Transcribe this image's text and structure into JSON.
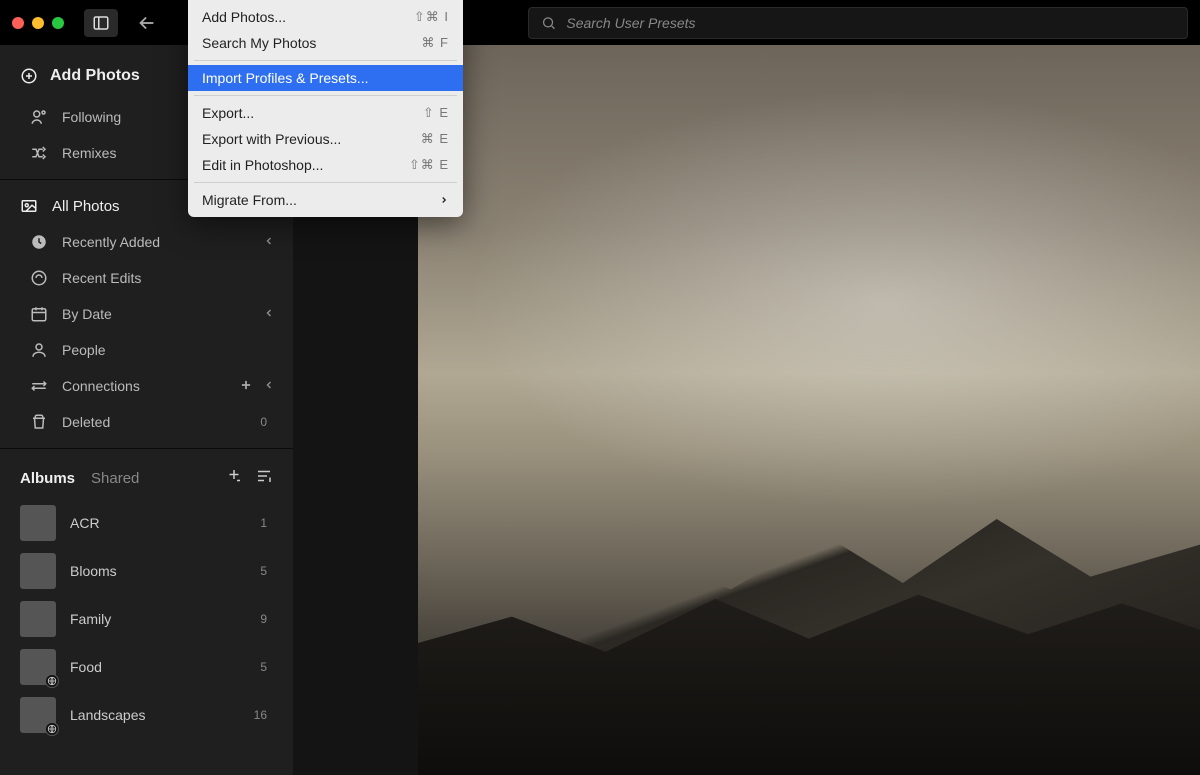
{
  "search": {
    "placeholder": "Search User Presets"
  },
  "addPhotos": "Add Photos",
  "nav": {
    "following": "Following",
    "remixes": "Remixes"
  },
  "library": {
    "allPhotos": "All Photos",
    "recentlyAdded": "Recently Added",
    "recentEdits": "Recent Edits",
    "byDate": "By Date",
    "people": "People",
    "connections": "Connections",
    "deleted": "Deleted",
    "deletedCount": "0"
  },
  "albumsHeader": {
    "albums": "Albums",
    "shared": "Shared"
  },
  "albums": [
    {
      "name": "ACR",
      "count": "1"
    },
    {
      "name": "Blooms",
      "count": "5"
    },
    {
      "name": "Family",
      "count": "9"
    },
    {
      "name": "Food",
      "count": "5"
    },
    {
      "name": "Landscapes",
      "count": "16"
    }
  ],
  "menu": {
    "addPhotos": {
      "label": "Add Photos...",
      "shortcut": "⇧⌘ I"
    },
    "searchMy": {
      "label": "Search My Photos",
      "shortcut": "⌘ F"
    },
    "importPresets": {
      "label": "Import Profiles & Presets..."
    },
    "export": {
      "label": "Export...",
      "shortcut": "⇧ E"
    },
    "exportPrev": {
      "label": "Export with Previous...",
      "shortcut": "⌘ E"
    },
    "editPs": {
      "label": "Edit in Photoshop...",
      "shortcut": "⇧⌘ E"
    },
    "migrate": {
      "label": "Migrate From..."
    }
  }
}
